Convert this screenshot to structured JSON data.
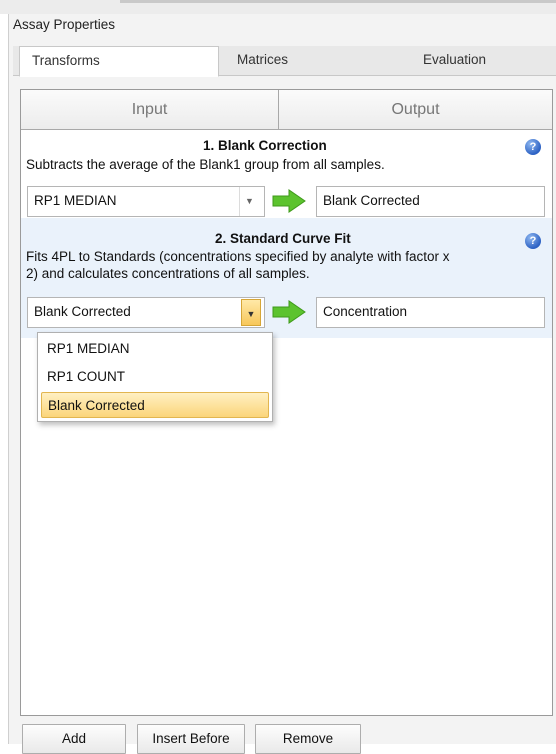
{
  "panel": {
    "title": "Assay Properties"
  },
  "tabs": [
    {
      "label": "Transforms",
      "active": true
    },
    {
      "label": "Matrices",
      "active": false
    },
    {
      "label": "Evaluation",
      "active": false
    }
  ],
  "io_header": {
    "input": "Input",
    "output": "Output"
  },
  "steps": [
    {
      "heading": "1. Blank Correction",
      "description": "Subtracts the average of the Blank1 group from all samples.",
      "input_value": "RP1 MEDIAN",
      "output_value": "Blank Corrected",
      "help_icon": "help-icon"
    },
    {
      "heading": "2. Standard Curve Fit",
      "description_line1": "Fits 4PL to Standards (concentrations specified by analyte with factor x",
      "description_line2": "2) and calculates concentrations of all samples.",
      "input_value": "Blank Corrected",
      "output_value": "Concentration",
      "help_icon": "help-icon"
    }
  ],
  "dropdown": {
    "options": [
      "RP1 MEDIAN",
      "RP1 COUNT",
      "Blank Corrected"
    ],
    "selected": "Blank Corrected"
  },
  "buttons": {
    "add": "Add",
    "insert_before": "Insert Before",
    "remove": "Remove"
  },
  "colors": {
    "arrow_green": "#5cc32e",
    "selected_highlight": "#fbd57a",
    "help_blue": "#2d62c4"
  }
}
